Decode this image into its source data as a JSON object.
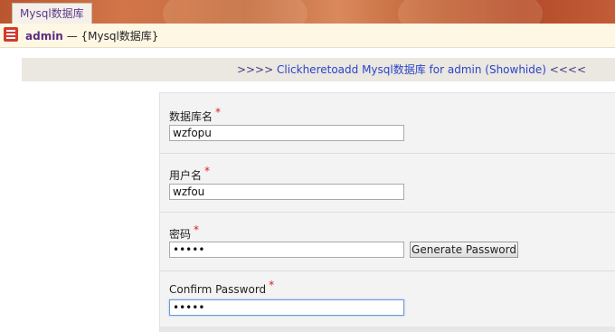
{
  "tab": {
    "label": "Mysql数据库"
  },
  "header": {
    "user": "admin",
    "separator": "—",
    "title": "{Mysql数据库}"
  },
  "linkbar": {
    "prefix": ">>>>",
    "link_text": "Clickheretoadd Mysql数据库 for admin (Showhide)",
    "suffix": "<<<<"
  },
  "form": {
    "required_mark": "*",
    "fields": [
      {
        "label": "数据库名",
        "value": "wzfopu"
      },
      {
        "label": "用户名",
        "value": "wzfou"
      },
      {
        "label": "密码",
        "value": "•••••"
      },
      {
        "label": "Confirm Password",
        "value": "•••••"
      }
    ],
    "generate_button": "Generate Password"
  },
  "colors": {
    "brand_purple": "#5b2c83",
    "link_blue": "#2a44c8",
    "required_red": "#d81f1f"
  }
}
